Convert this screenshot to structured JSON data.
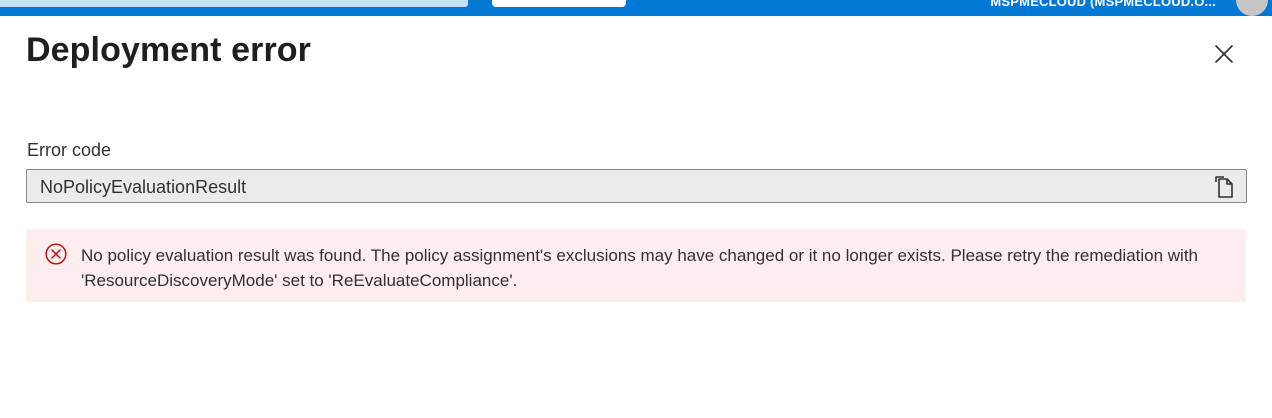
{
  "header": {
    "account_label": "MSPMECLOUD (MSPMECLOUD.O...",
    "accent_color": "#0078d4"
  },
  "dialog": {
    "title": "Deployment error",
    "close_icon": "close-icon",
    "error_code_label": "Error code",
    "error_code_value": "NoPolicyEvaluationResult",
    "copy_icon": "copy-icon",
    "error_icon": "error-circle-icon",
    "error_color": "#c50f1f",
    "error_background": "#fdeded",
    "error_message": "No policy evaluation result was found. The policy assignment's exclusions may have changed or it no longer exists. Please retry the remediation with 'ResourceDiscoveryMode' set to 'ReEvaluateCompliance'."
  }
}
